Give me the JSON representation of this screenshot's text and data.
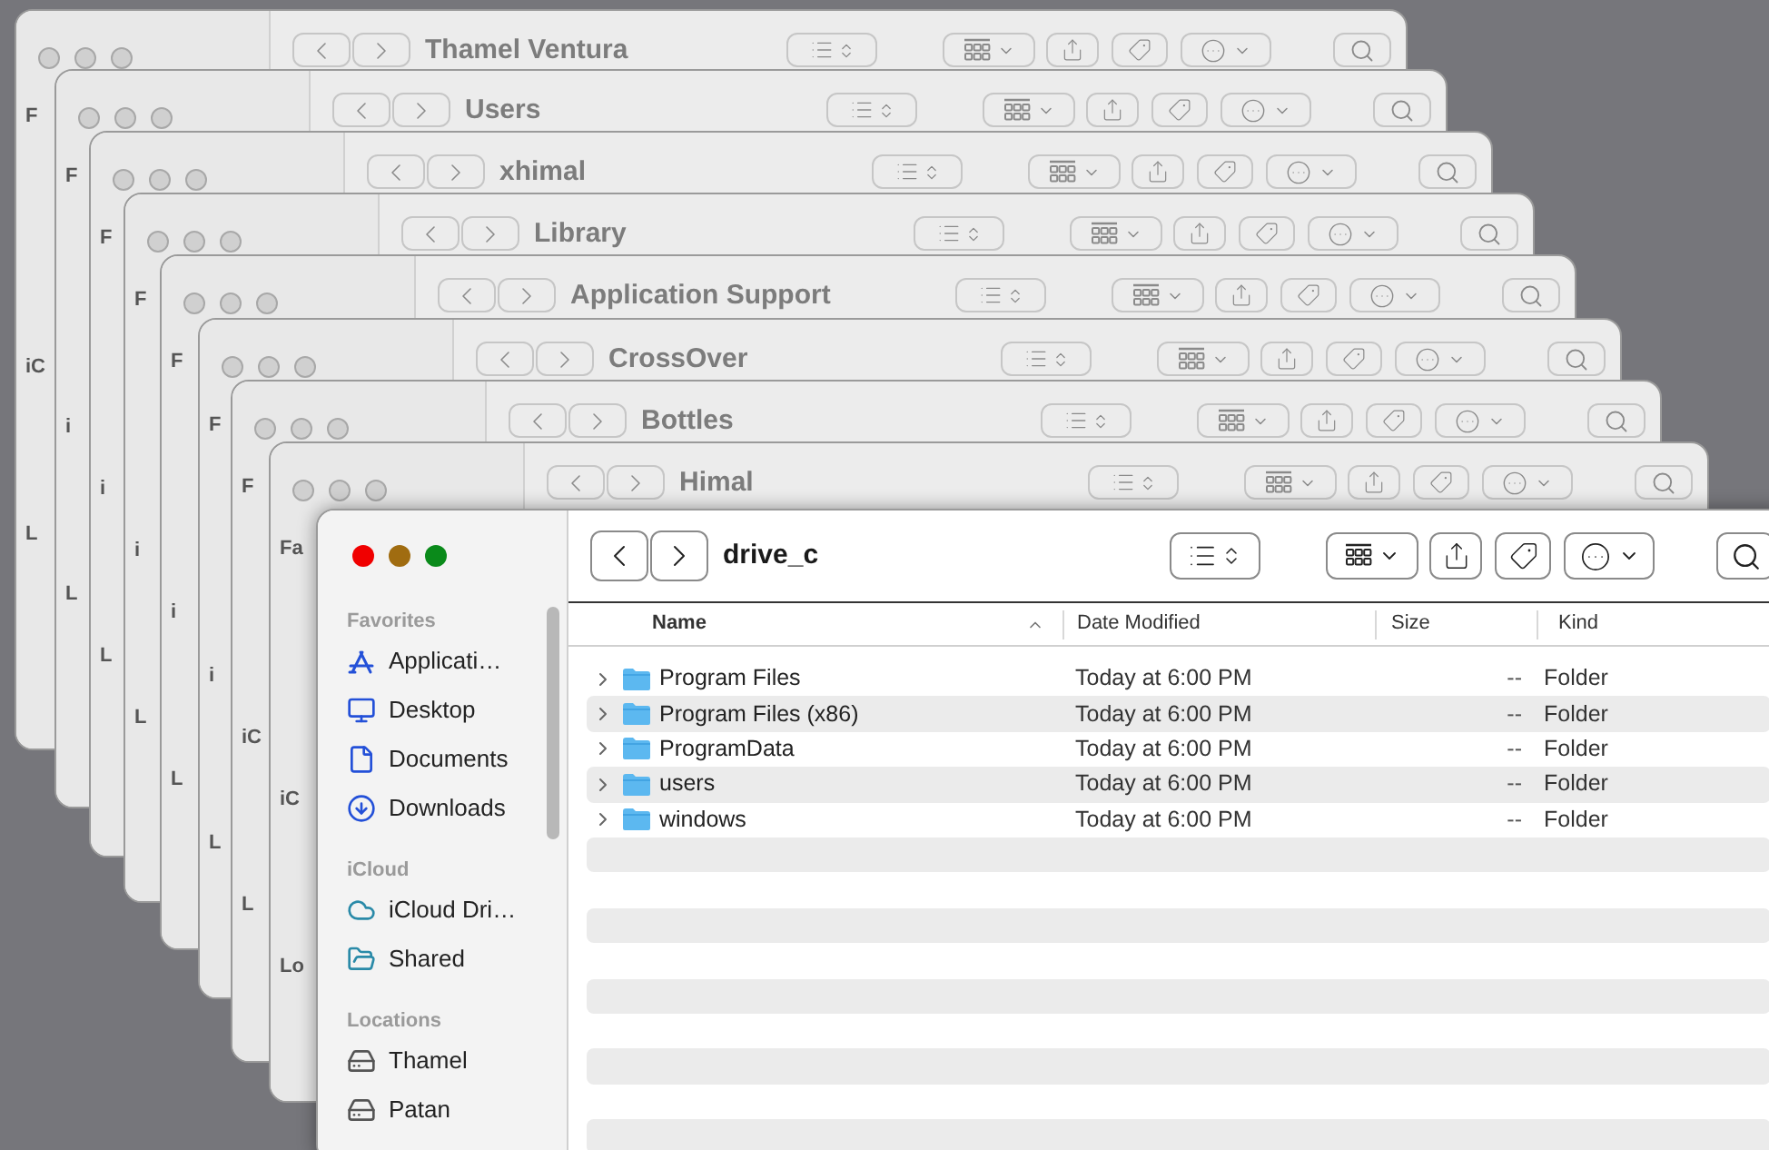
{
  "back_windows": [
    {
      "title": "Thamel Ventura",
      "sidebar_peek": [
        "F",
        "iC",
        "L"
      ]
    },
    {
      "title": "Users",
      "sidebar_peek": [
        "F",
        "i",
        "L"
      ]
    },
    {
      "title": "xhimal",
      "sidebar_peek": [
        "F",
        "i",
        "L"
      ]
    },
    {
      "title": "Library",
      "sidebar_peek": [
        "F",
        "i",
        "L"
      ]
    },
    {
      "title": "Application Support",
      "sidebar_peek": [
        "F",
        "i",
        "L"
      ]
    },
    {
      "title": "CrossOver",
      "sidebar_peek": [
        "F",
        "i",
        "L"
      ]
    },
    {
      "title": "Bottles",
      "sidebar_peek": [
        "F",
        "iC",
        "L"
      ]
    },
    {
      "title": "Himal",
      "sidebar_peek": [
        "Fa",
        "iC",
        "Lo"
      ]
    }
  ],
  "window": {
    "title": "drive_c",
    "sidebar": [
      {
        "heading": "Favorites",
        "items": [
          {
            "label": "Applicati…"
          },
          {
            "label": "Desktop"
          },
          {
            "label": "Documents"
          },
          {
            "label": "Downloads"
          }
        ]
      },
      {
        "heading": "iCloud",
        "items": [
          {
            "label": "iCloud Dri…"
          },
          {
            "label": "Shared"
          }
        ]
      },
      {
        "heading": "Locations",
        "items": [
          {
            "label": "Thamel"
          },
          {
            "label": "Patan"
          }
        ]
      }
    ],
    "table": {
      "columns": [
        {
          "label": "Name",
          "sorted": true
        },
        {
          "label": "Date Modified",
          "sorted": false
        },
        {
          "label": "Size",
          "sorted": false
        },
        {
          "label": "Kind",
          "sorted": false
        }
      ],
      "rows": [
        {
          "name": "Program Files",
          "date": "Today at 6:00 PM",
          "size": "--",
          "kind": "Folder"
        },
        {
          "name": "Program Files (x86)",
          "date": "Today at 6:00 PM",
          "size": "--",
          "kind": "Folder"
        },
        {
          "name": "ProgramData",
          "date": "Today at 6:00 PM",
          "size": "--",
          "kind": "Folder"
        },
        {
          "name": "users",
          "date": "Today at 6:00 PM",
          "size": "--",
          "kind": "Folder"
        },
        {
          "name": "windows",
          "date": "Today at 6:00 PM",
          "size": "--",
          "kind": "Folder"
        }
      ]
    }
  }
}
